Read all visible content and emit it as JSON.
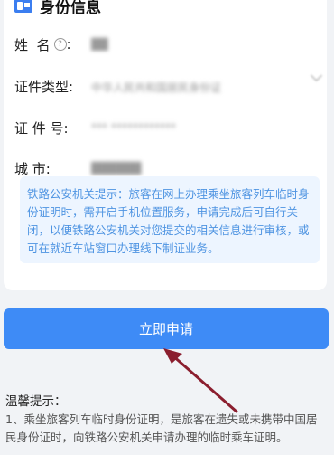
{
  "identity_section": {
    "title": "身份信息",
    "icon": "id-card-icon"
  },
  "fields": [
    {
      "label": "姓  名",
      "value": "██"
    },
    {
      "label": "证件类型:",
      "value": "中华人民共和国居民身份证"
    },
    {
      "label": "证 件 号:",
      "value": "*** ************"
    },
    {
      "label": "城      市:",
      "value": "██████"
    }
  ],
  "notice": {
    "text": "铁路公安机关提示：旅客在网上办理乘坐旅客列车临时身份证明时，需开启手机位置服务，申请完成后可自行关闭，以便铁路公安机关对您提交的相关信息进行审核，或可在就近车站窗口办理线下制证业务。"
  },
  "apply_button": {
    "label": "立即申请"
  },
  "tips": {
    "title": "温馨提示：",
    "body": "1、乘坐旅客列车临时身份证明，是旅客在遗失或未携带中国居民身份证时，向铁路公安机关申请办理的临时乘车证明。"
  },
  "colors": {
    "primary": "#3e8bf6",
    "notice_bg": "#edf5ff",
    "notice_text": "#4e94e2",
    "annotation_arrow": "#8b1e2e"
  }
}
